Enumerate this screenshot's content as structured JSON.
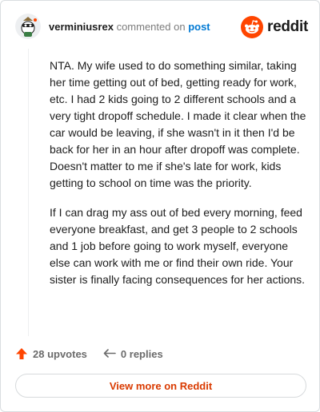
{
  "header": {
    "username": "verminiusrex",
    "action_text": "commented on",
    "post_link": "post",
    "brand": "reddit"
  },
  "comment": {
    "paragraphs": [
      "NTA. My wife used to do something similar, taking her time getting out of bed, getting ready for work, etc. I had 2 kids going to 2 different schools and a very tight dropoff schedule. I made it clear when the car would be leaving, if she wasn't in it then I'd be back for her in an hour after dropoff was complete. Doesn't matter to me if she's late for work, kids getting to school on time was the priority.",
      "If I can drag my ass out of bed every morning, feed everyone breakfast, and get 3 people to 2 schools and 1 job before going to work myself, everyone else can work with me or find their own ride. Your sister is finally facing consequences for her actions."
    ]
  },
  "actions": {
    "upvotes": "28 upvotes",
    "replies": "0 replies"
  },
  "view_more": "View more on Reddit",
  "colors": {
    "accent_orange": "#ff4500",
    "link_blue": "#0079d3",
    "view_more_text": "#d93a00"
  },
  "icons": {
    "avatar": "snoo-avatar",
    "brand": "reddit-logo-icon",
    "upvote": "upvote-arrow-icon",
    "reply": "reply-arrow-icon"
  }
}
